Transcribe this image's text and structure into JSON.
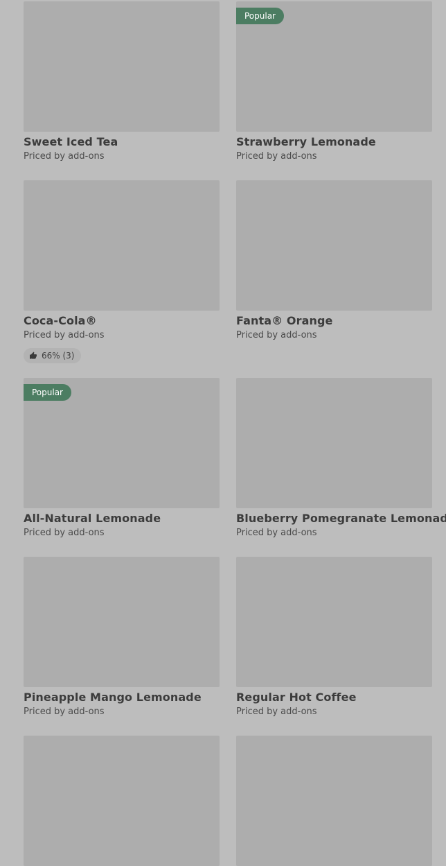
{
  "menu": {
    "items": [
      {
        "name": "Sweet Iced Tea",
        "price": "Priced by add-ons",
        "badge": ""
      },
      {
        "name": "Strawberry Lemonade",
        "price": "Priced by add-ons",
        "badge": "Popular"
      },
      {
        "name": "Coca-Cola®",
        "price": "Priced by add-ons",
        "badge": "",
        "rating": "66% (3)"
      },
      {
        "name": "Fanta® Orange",
        "price": "Priced by add-ons",
        "badge": ""
      },
      {
        "name": "All-Natural Lemonade",
        "price": "Priced by add-ons",
        "badge": "Popular"
      },
      {
        "name": "Blueberry Pomegranate Lemonade",
        "price": "Priced by add-ons",
        "badge": ""
      },
      {
        "name": "Pineapple Mango Lemonade",
        "price": "Priced by add-ons",
        "badge": ""
      },
      {
        "name": "Regular Hot Coffee",
        "price": "Priced by add-ons",
        "badge": ""
      }
    ]
  },
  "colors": {
    "background": "#bdbdbd",
    "thumb": "#adadad",
    "badge": "#4c7d62"
  },
  "icons": {
    "rating": "thumbs-up-icon"
  }
}
